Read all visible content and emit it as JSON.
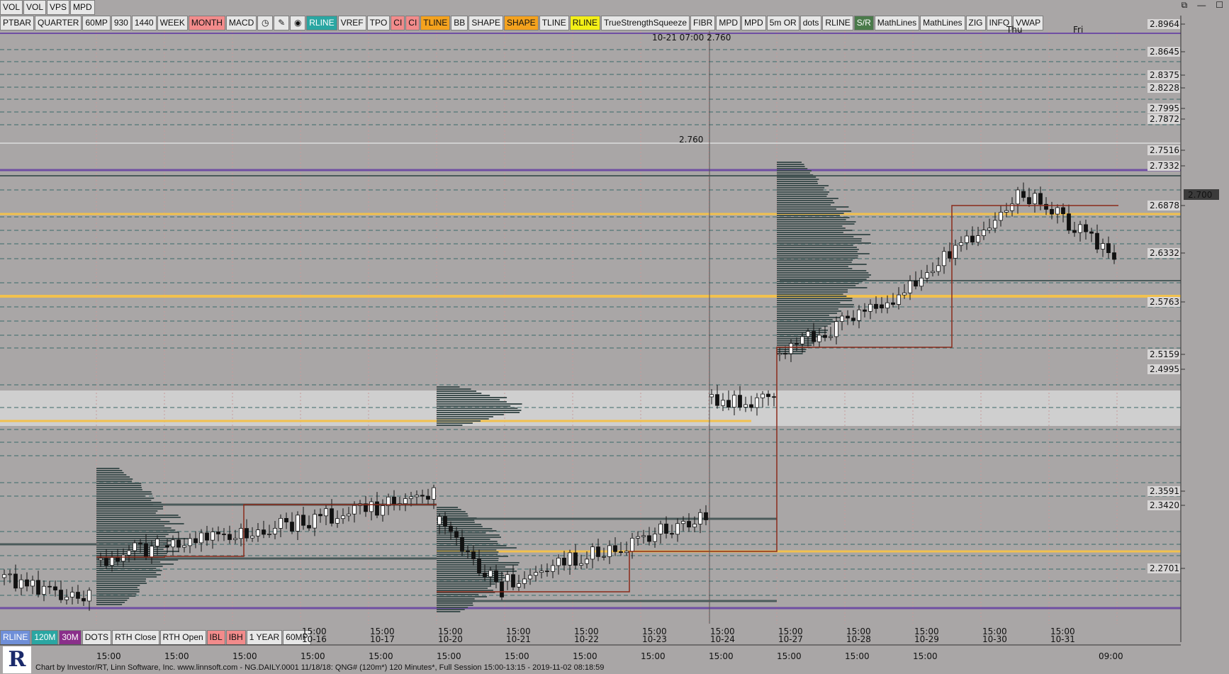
{
  "top_toolbar_1": [
    "VOL",
    "VOL",
    "VPS",
    "MPD"
  ],
  "top_toolbar_2": [
    {
      "label": "PTBAR",
      "style": ""
    },
    {
      "label": "QUARTER",
      "style": ""
    },
    {
      "label": "60MP",
      "style": ""
    },
    {
      "label": "930",
      "style": ""
    },
    {
      "label": "1440",
      "style": ""
    },
    {
      "label": "WEEK",
      "style": ""
    },
    {
      "label": "MONTH",
      "style": "pink"
    },
    {
      "label": "MACD",
      "style": ""
    },
    {
      "label": "◷",
      "style": "icon"
    },
    {
      "label": "✎",
      "style": "icon"
    },
    {
      "label": "◉",
      "style": "icon"
    },
    {
      "label": "RLINE",
      "style": "teal"
    },
    {
      "label": "VREF",
      "style": ""
    },
    {
      "label": "TPO",
      "style": ""
    },
    {
      "label": "CI",
      "style": "pink"
    },
    {
      "label": "CI",
      "style": "pink"
    },
    {
      "label": "TLINE",
      "style": "orange"
    },
    {
      "label": "BB",
      "style": ""
    },
    {
      "label": "SHAPE",
      "style": ""
    },
    {
      "label": "SHAPE",
      "style": "orange"
    },
    {
      "label": "TLINE",
      "style": ""
    },
    {
      "label": "RLINE",
      "style": "yellow"
    },
    {
      "label": "TrueStrengthSqueeze",
      "style": ""
    },
    {
      "label": "FIBR",
      "style": ""
    },
    {
      "label": "MPD",
      "style": ""
    },
    {
      "label": "MPD",
      "style": ""
    },
    {
      "label": "5m OR",
      "style": ""
    },
    {
      "label": "dots",
      "style": ""
    },
    {
      "label": "RLINE",
      "style": ""
    },
    {
      "label": "S/R",
      "style": "green"
    },
    {
      "label": "MathLines",
      "style": ""
    },
    {
      "label": "MathLines",
      "style": ""
    },
    {
      "label": "ZIG",
      "style": ""
    },
    {
      "label": "INFO",
      "style": ""
    },
    {
      "label": "VWAP",
      "style": ""
    }
  ],
  "bottom_toolbar": [
    {
      "label": "RLINE",
      "style": "blue"
    },
    {
      "label": "120M",
      "style": "teal"
    },
    {
      "label": "30M",
      "style": "purple"
    },
    {
      "label": "DOTS",
      "style": ""
    },
    {
      "label": "RTH Close",
      "style": ""
    },
    {
      "label": "RTH Open",
      "style": ""
    },
    {
      "label": "IBL",
      "style": "pink"
    },
    {
      "label": "IBH",
      "style": "pink"
    },
    {
      "label": "1 YEAR",
      "style": ""
    },
    {
      "label": "60MP",
      "style": ""
    }
  ],
  "crosshair_info": {
    "time": "10-21 07:00",
    "price": "2.760"
  },
  "crosshair_price_label": "2.760",
  "current_price": "2.700",
  "day_labels": [
    "Thu",
    "Fri"
  ],
  "price_labels": [
    "2.8964",
    "2.8645",
    "2.8375",
    "2.8228",
    "2.7995",
    "2.7872",
    "2.7516",
    "2.7332",
    "2.6878",
    "2.6332",
    "2.5763",
    "2.5159",
    "2.4995",
    "2.3591",
    "2.3420",
    "2.2701"
  ],
  "x_session_labels": [
    {
      "time": "15:00",
      "date": "10-16"
    },
    {
      "time": "15:00",
      "date": "10-17"
    },
    {
      "time": "15:00",
      "date": "10-20"
    },
    {
      "time": "15:00",
      "date": "10-21"
    },
    {
      "time": "15:00",
      "date": "10-22"
    },
    {
      "time": "15:00",
      "date": "10-23"
    },
    {
      "time": "15:00",
      "date": "10-24"
    },
    {
      "time": "15:00",
      "date": "10-27"
    },
    {
      "time": "15:00",
      "date": "10-28"
    },
    {
      "time": "15:00",
      "date": "10-29"
    },
    {
      "time": "15:00",
      "date": "10-30"
    },
    {
      "time": "15:00",
      "date": "10-31"
    }
  ],
  "x_axis_labels": [
    "15:00",
    "15:00",
    "15:00",
    "15:00",
    "15:00",
    "15:00",
    "15:00",
    "15:00",
    "15:00",
    "15:00",
    "15:00",
    "15:00",
    "15:00",
    "09:00"
  ],
  "footer": "Chart by Investor/RT, Linn Software, Inc. www.linnsoft.com - NG.DAILY.0001  11/18/18: QNG# (120m*) 120 Minutes*, Full Session 15:00-13:15 - 2019-11-02 08:18:59",
  "logo": "R",
  "window_controls": [
    "⧉",
    "—",
    "☐"
  ],
  "colors": {
    "background": "#a9a6a6",
    "orange_level": "#f2c14e",
    "purple_level": "#6f4fa3",
    "dark_level": "#4a5a5a",
    "profile": "#3f4f4f",
    "vwap": "#8b2a1a"
  }
}
